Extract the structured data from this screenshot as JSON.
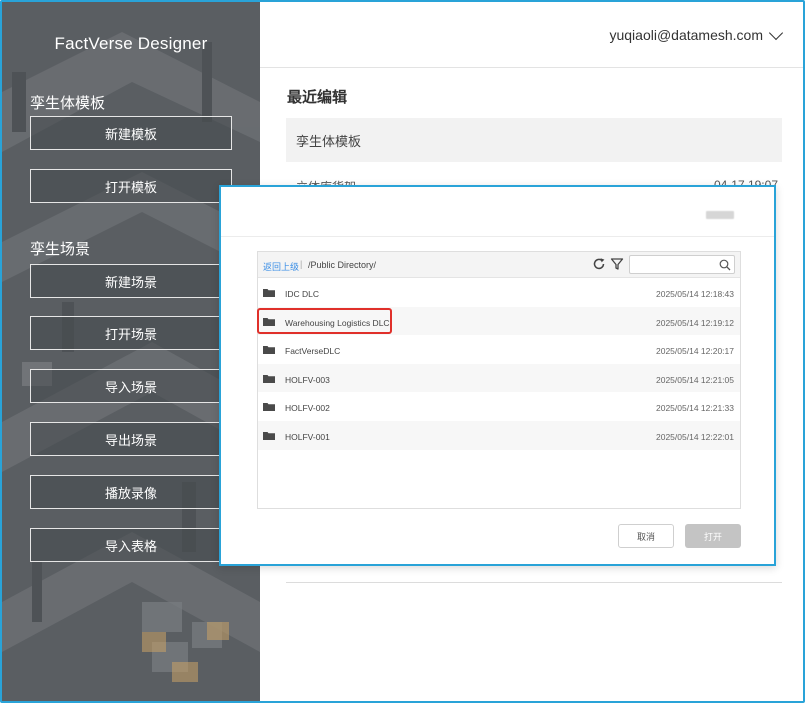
{
  "app": {
    "title": "FactVerse Designer"
  },
  "sidebar": {
    "twin_section": {
      "title": "孪生体模板",
      "buttons": [
        "新建模板",
        "打开模板"
      ]
    },
    "scene_section": {
      "title": "孪生场景",
      "buttons": [
        "新建场景",
        "打开场景",
        "导入场景",
        "导出场景",
        "播放录像",
        "导入表格"
      ]
    }
  },
  "header": {
    "user": "yuqiaoli@datamesh.com"
  },
  "recent": {
    "title": "最近编辑",
    "tab": "孪生体模板",
    "partial_row": {
      "name": "立体库货架",
      "date": "04-17 19:07"
    }
  },
  "dialog": {
    "toolbar": {
      "back_label": "返回上级",
      "separator": "|",
      "path": "/Public Directory/"
    },
    "files": [
      {
        "name": "IDC DLC",
        "date": "2025/05/14 12:18:43"
      },
      {
        "name": "Warehousing Logistics DLC",
        "date": "2025/05/14 12:19:12",
        "highlighted": true
      },
      {
        "name": "FactVerseDLC",
        "date": "2025/05/14 12:20:17"
      },
      {
        "name": "HOLFV-003",
        "date": "2025/05/14 12:21:05"
      },
      {
        "name": "HOLFV-002",
        "date": "2025/05/14 12:21:33"
      },
      {
        "name": "HOLFV-001",
        "date": "2025/05/14 12:22:01"
      }
    ],
    "cancel_label": "取消",
    "open_label": "打开"
  },
  "colors": {
    "accent": "#29a3d8",
    "highlight": "#e0302a",
    "link": "#3a8ee6",
    "sidebar": "#5b5f63"
  }
}
